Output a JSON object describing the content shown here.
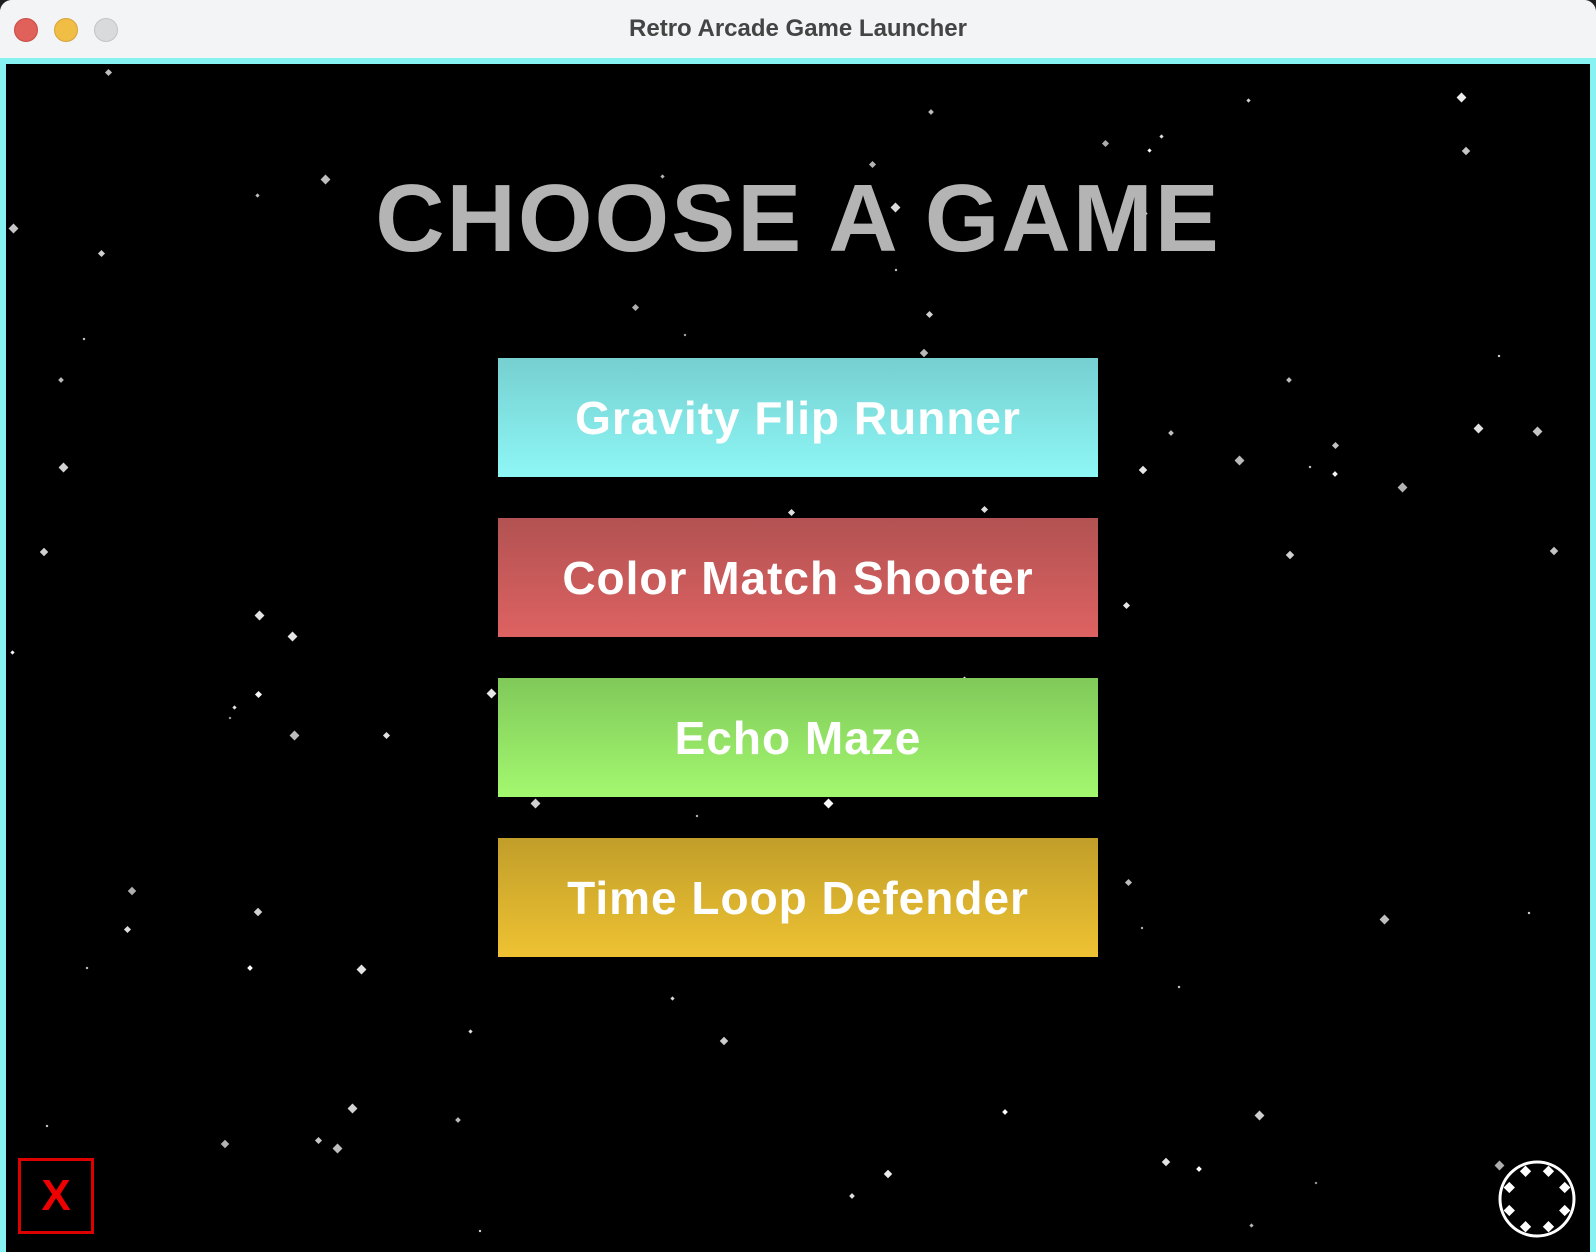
{
  "window": {
    "title": "Retro Arcade Game Launcher"
  },
  "screen": {
    "heading": "CHOOSE A GAME",
    "games": [
      {
        "label": "Gravity Flip Runner",
        "color": "#8ef7f6"
      },
      {
        "label": "Color Match Shooter",
        "color": "#de6262"
      },
      {
        "label": "Echo Maze",
        "color": "#a3f86f"
      },
      {
        "label": "Time Loop Defender",
        "color": "#eec232"
      }
    ],
    "exit_label": "X",
    "settings_icon": "gear-icon"
  }
}
